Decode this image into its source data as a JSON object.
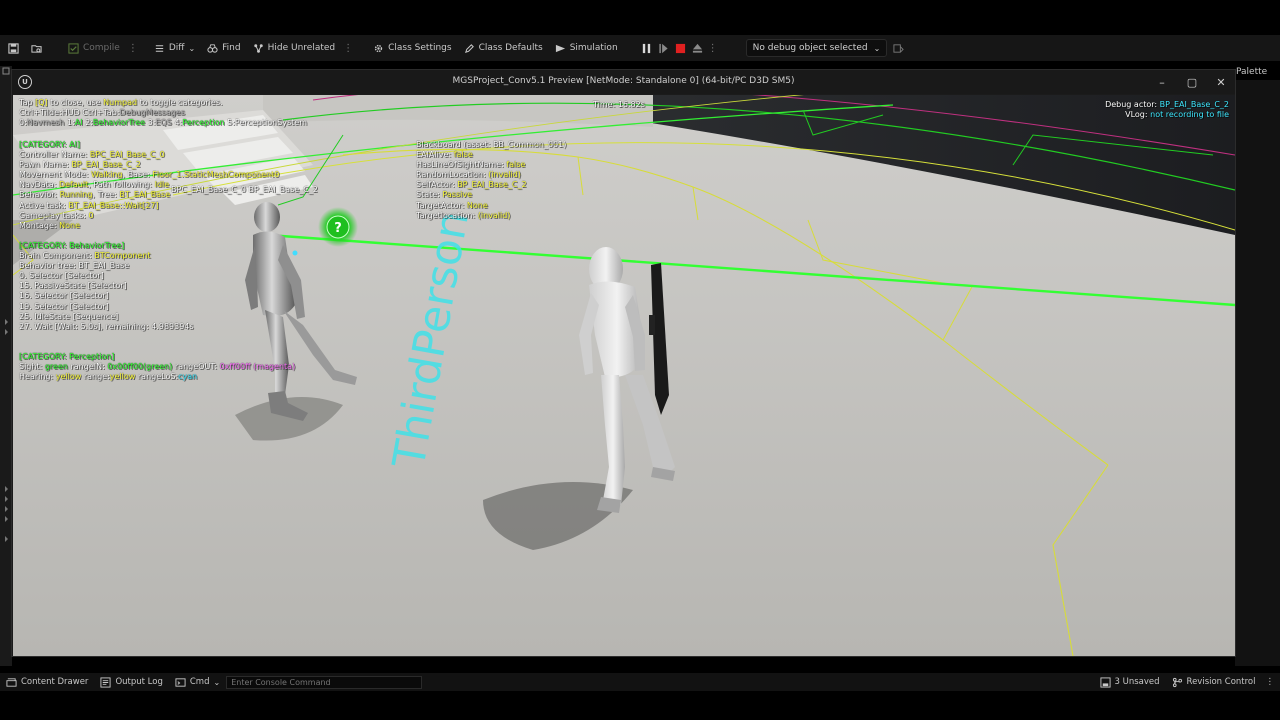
{
  "toolbar": {
    "compile": "Compile",
    "diff": "Diff",
    "find": "Find",
    "hide_unrelated": "Hide Unrelated",
    "class_settings": "Class Settings",
    "class_defaults": "Class Defaults",
    "simulation": "Simulation",
    "debug_object": "No debug object selected"
  },
  "palette_label": "Palette",
  "preview": {
    "title": "MGSProject_Conv5.1 Preview [NetMode: Standalone 0]  (64-bit/PC D3D SM5)",
    "logo": "U"
  },
  "hud": {
    "help": {
      "l1_a": "Tap ",
      "l1_key": "[Q]",
      "l1_b": " to close, use ",
      "l1_num": "Numpad",
      "l1_c": " to toggle categories.",
      "l2_a": "Ctrl+Tilde:",
      "l2_b": "HUD  ",
      "l2_c": "Ctrl+Tab:",
      "l2_d": "DebugMessages",
      "l3": [
        {
          "key": "0:",
          "label": "Navmesh",
          "color": "gr"
        },
        {
          "key": "1:",
          "label": "AI",
          "color": "g"
        },
        {
          "key": "2:",
          "label": "BehaviorTree",
          "color": "g"
        },
        {
          "key": "3:",
          "label": "EQS",
          "color": "gr"
        },
        {
          "key": "4:",
          "label": "Perception",
          "color": "g"
        },
        {
          "key": "5:",
          "label": "PerceptionSystem",
          "color": "w"
        }
      ]
    },
    "time": "Time: 16.82s",
    "debug_actor_label": "Debug actor: ",
    "debug_actor_value": "BP_EAI_Base_C_2",
    "vlog_label": "VLog: ",
    "vlog_value": "not recording to file",
    "ai": [
      {
        "k": "[CATEGORY: AI]",
        "v": "",
        "kc": "g",
        "vc": "y"
      },
      {
        "k": "Controller Name: ",
        "v": "BPC_EAI_Base_C_0",
        "kc": "w",
        "vc": "y"
      },
      {
        "k": "Pawn Name: ",
        "v": "BP_EAI_Base_C_2",
        "kc": "w",
        "vc": "y"
      },
      {
        "k": "Movement Mode: ",
        "v": "Walking",
        "k2": ", Base: ",
        "v2": "Floor_1.StaticMeshComponent0",
        "kc": "w",
        "vc": "y"
      },
      {
        "k": "NavData: ",
        "v": "Default",
        "k2": ", Path following: ",
        "v2": "Idle",
        "kc": "w",
        "vc": "y"
      },
      {
        "k": "Behavior: ",
        "v": "Running",
        "k2": ", Tree: ",
        "v2": "BT_EAI_Base",
        "kc": "w",
        "vc": "y"
      },
      {
        "k": "Active task: ",
        "v": "BT_EAI_Base::Wait[27]",
        "kc": "w",
        "vc": "y"
      },
      {
        "k": "Gameplay tasks: ",
        "v": "0",
        "kc": "w",
        "vc": "y"
      },
      {
        "k": "Montage: ",
        "v": "None",
        "kc": "w",
        "vc": "y"
      }
    ],
    "bt": [
      {
        "k": "[CATEGORY: BehaviorTree]",
        "v": "",
        "kc": "g",
        "vc": "y"
      },
      {
        "k": "Brain Component: ",
        "v": "BTComponent",
        "kc": "w",
        "vc": "y"
      },
      {
        "k": "Behavior tree: ",
        "v": "BT_EAI_Base",
        "kc": "w",
        "vc": "w"
      },
      {
        "k": "  0. Selector [Selector]",
        "v": "",
        "kc": "w",
        "vc": "w"
      },
      {
        "k": "  15. PassiveState [Selector]",
        "v": "",
        "kc": "w",
        "vc": "w"
      },
      {
        "k": "  16. Selector [Selector]",
        "v": "",
        "kc": "w",
        "vc": "w"
      },
      {
        "k": "  19. Selector [Selector]",
        "v": "",
        "kc": "w",
        "vc": "w"
      },
      {
        "k": "  25. IdleState [Sequence]",
        "v": "",
        "kc": "w",
        "vc": "w"
      },
      {
        "k": "  27. Wait [Wait: 5.0s], remaining: 4.989394s",
        "v": "",
        "kc": "w",
        "vc": "w"
      }
    ],
    "perception": {
      "header": "[CATEGORY: Perception]",
      "sight_label": "Sight: ",
      "sight_green": "green",
      "sight_rangein": " rangeIN: ",
      "sight_rangein_v": "0x00ff00(green)",
      "sight_rangeout": " rangeOUT: ",
      "sight_rangeout_v": "0xff00ff (magenta)",
      "hearing_label": "Hearing: ",
      "hearing_yellow": "yellow",
      "hearing_range": " range:",
      "hearing_range_v": "yellow",
      "hearing_los": "  rangeLoS:",
      "hearing_los_v": "cyan"
    },
    "blackboard": [
      {
        "k": "Blackboard (asset: BB_Common_001)",
        "v": "",
        "kc": "w",
        "vc": "w"
      },
      {
        "k": "  EAIAlive: ",
        "v": "false",
        "kc": "w",
        "vc": "y"
      },
      {
        "k": "  HasLineOfSightName: ",
        "v": "false",
        "kc": "w",
        "vc": "y"
      },
      {
        "k": "  RandomLocation: ",
        "v": "(invalid)",
        "kc": "w",
        "vc": "y"
      },
      {
        "k": "  SelfActor: ",
        "v": "BP_EAI_Base_C_2",
        "kc": "w",
        "vc": "y"
      },
      {
        "k": "  State: ",
        "v": "Passive",
        "kc": "w",
        "vc": "y"
      },
      {
        "k": "  TargetActor: ",
        "v": "None",
        "kc": "w",
        "vc": "y"
      },
      {
        "k": "  Targetlocation: ",
        "v": "(invalid)",
        "kc": "w",
        "vc": "y"
      }
    ],
    "pawn_tag": "BPC_EAI_Base_C_0 BP_EAI_Base_C_2",
    "floor_text": "ThirdPerson"
  },
  "statusbar": {
    "content_drawer": "Content Drawer",
    "output_log": "Output Log",
    "cmd": "Cmd",
    "console_placeholder": "Enter Console Command",
    "unsaved": "3 Unsaved",
    "revision_control": "Revision Control"
  },
  "colors": {
    "accent_green": "#33ff33",
    "hud_yellow": "#ffff40",
    "hud_cyan": "#40e8ff",
    "stop_red": "#e02020"
  }
}
